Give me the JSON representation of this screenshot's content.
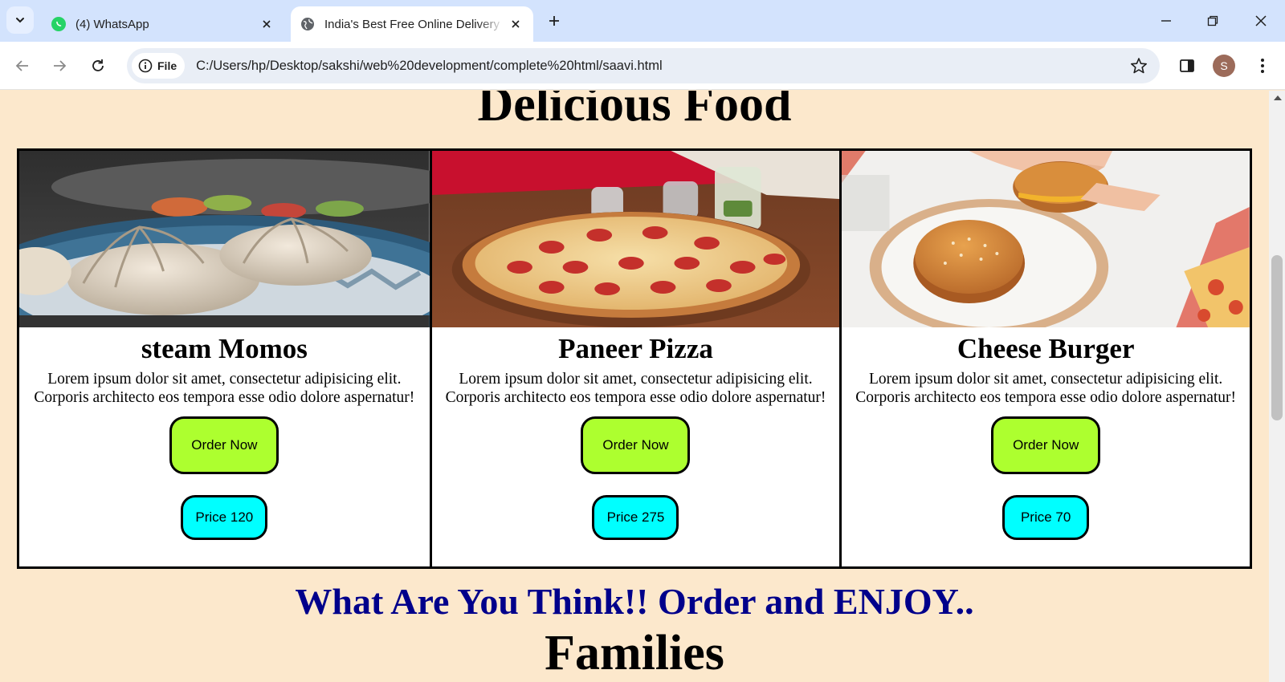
{
  "browser": {
    "tabs": [
      {
        "title": "(4) WhatsApp",
        "favicon": "whatsapp-icon",
        "active": false
      },
      {
        "title": "India's Best Free Online Delivery",
        "favicon": "globe-icon",
        "active": true
      }
    ],
    "address": {
      "chip_label": "File",
      "url": "C:/Users/hp/Desktop/sakshi/web%20development/complete%20html/saavi.html"
    },
    "profile_initial": "S",
    "tabstrip_color": "#d3e3fd"
  },
  "page": {
    "background": "#fce8cc",
    "section_heading": "Delicious Food",
    "cards": [
      {
        "name": "steam Momos",
        "description": "Lorem ipsum dolor sit amet, consectetur adipisicing elit. Corporis architecto eos tempora esse odio dolore aspernatur!",
        "order_label": "Order Now",
        "price_label": "Price 120",
        "image": "momos-photo"
      },
      {
        "name": "Paneer Pizza",
        "description": "Lorem ipsum dolor sit amet, consectetur adipisicing elit. Corporis architecto eos tempora esse odio dolore aspernatur!",
        "order_label": "Order Now",
        "price_label": "Price 275",
        "image": "pizza-photo"
      },
      {
        "name": "Cheese Burger",
        "description": "Lorem ipsum dolor sit amet, consectetur adipisicing elit. Corporis architecto eos tempora esse odio dolore aspernatur!",
        "order_label": "Order Now",
        "price_label": "Price 70",
        "image": "burger-photo"
      }
    ],
    "tagline": "What Are You Think!! Order and ENJOY..",
    "next_heading": "Families",
    "colors": {
      "order_button": "#adff2f",
      "price_button": "#00ffff",
      "tagline": "#00008b"
    }
  }
}
